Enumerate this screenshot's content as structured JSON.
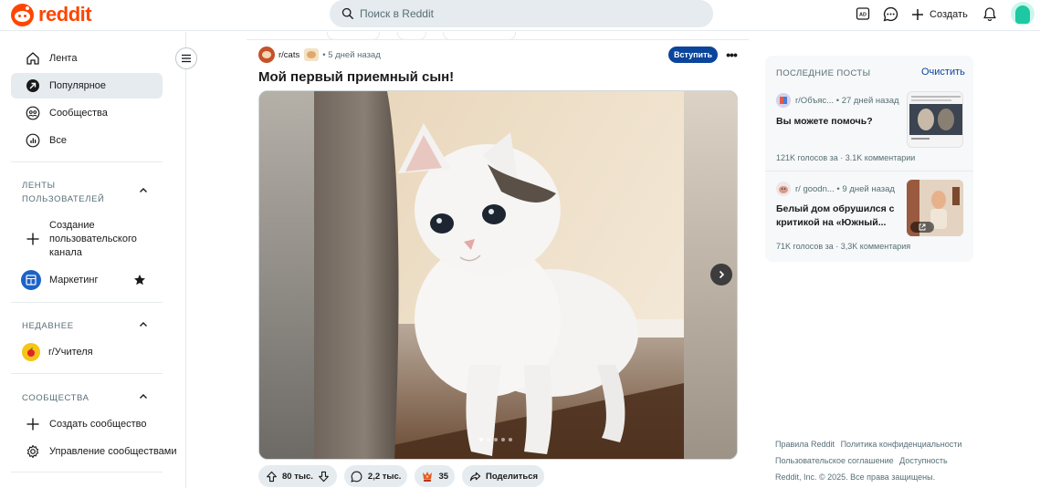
{
  "header": {
    "logo_text": "reddit",
    "search_placeholder": "Поиск в Reddit",
    "create_label": "Создать"
  },
  "sidebar": {
    "nav": [
      {
        "label": "Лента",
        "icon": "home-icon"
      },
      {
        "label": "Популярное",
        "icon": "popular-icon",
        "active": true
      },
      {
        "label": "Сообщества",
        "icon": "communities-icon"
      },
      {
        "label": "Все",
        "icon": "all-icon"
      }
    ],
    "custom_feeds": {
      "heading": "ЛЕНТЫ ПОЛЬЗОВАТЕЛЕЙ",
      "create_label": "Создание пользовательского канала",
      "feed_label": "Маркетинг"
    },
    "recent": {
      "heading": "НЕДАВНЕЕ",
      "item_label": "r/Учителя"
    },
    "communities": {
      "heading": "СООБЩЕСТВА",
      "create_label": "Создать сообщество",
      "manage_label": "Управление сообществами"
    }
  },
  "post": {
    "subreddit": "r/cats",
    "time": "5 дней назад",
    "join_label": "Вступить",
    "title": "Мой первый приемный сын!",
    "gallery": {
      "count": 5,
      "current": 1
    },
    "actions": {
      "votes": "80 тыс.",
      "comments": "2,2 тыс.",
      "awards": "35",
      "share": "Поделиться"
    }
  },
  "recent_posts": {
    "heading": "ПОСЛЕДНИЕ ПОСТЫ",
    "clear_label": "Очистить",
    "items": [
      {
        "subreddit": "r/Объяс...",
        "time": "27 дней назад",
        "title": "Вы можете помочь?",
        "stats": "121K голосов за · 3.1K комментарии"
      },
      {
        "subreddit": "r/ goodn...",
        "time": "9 дней назад",
        "title": "Белый дом обрушился с критикой на «Южный...",
        "stats": "71K голосов за · 3,3K комментария"
      }
    ]
  },
  "footer": {
    "rules": "Правила Reddit",
    "privacy": "Политика конфиденциальности",
    "agreement": "Пользовательское соглашение",
    "accessibility": "Доступность",
    "copyright": "Reddit, Inc. © 2025. Все права защищены."
  },
  "colors": {
    "brand": "#ff4500",
    "join_button": "#0a449b",
    "pill_bg": "#e5ebee",
    "active_nav_bg": "#e5ebee"
  }
}
